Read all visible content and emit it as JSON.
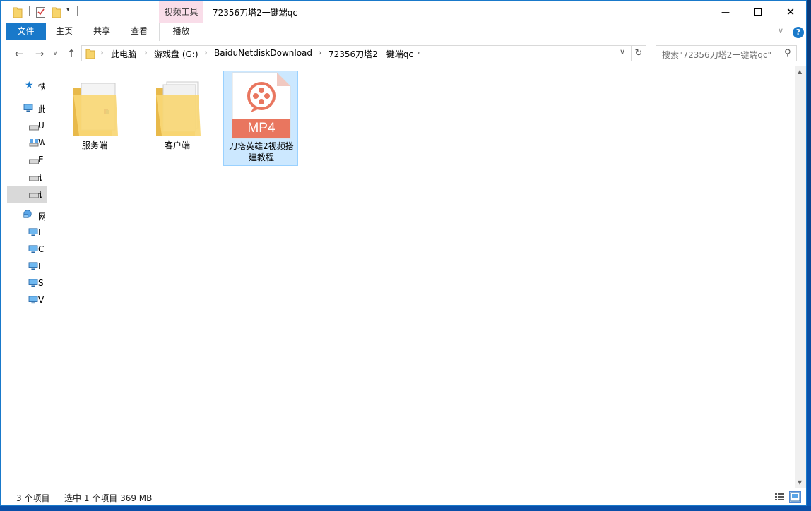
{
  "window": {
    "title": "72356刀塔2一键端qc",
    "context_tab": "视频工具",
    "controls": {
      "minimize": "—",
      "maximize": "☐",
      "close": "✕"
    }
  },
  "ribbon": {
    "tabs": [
      "文件",
      "主页",
      "共享",
      "查看",
      "播放"
    ],
    "help": "?"
  },
  "address": {
    "crumbs": [
      "此电脑",
      "游戏盘 (G:)",
      "BaiduNetdiskDownload",
      "72356刀塔2一键端qc"
    ],
    "search_placeholder": "搜索\"72356刀塔2一键端qc\""
  },
  "nav": {
    "items": [
      {
        "icon": "star-icon",
        "label": "快"
      },
      {
        "icon": "computer-icon",
        "label": "此"
      },
      {
        "icon": "drive-icon",
        "label": "U"
      },
      {
        "icon": "network-drive-icon",
        "label": "W"
      },
      {
        "icon": "drive-icon",
        "label": "E"
      },
      {
        "icon": "drive-icon",
        "label": "讠"
      },
      {
        "icon": "drive-icon",
        "label": "讠"
      },
      {
        "icon": "network-icon",
        "label": "网"
      },
      {
        "icon": "computer-icon",
        "label": "I"
      },
      {
        "icon": "computer-icon",
        "label": "C"
      },
      {
        "icon": "computer-icon",
        "label": "I"
      },
      {
        "icon": "computer-icon",
        "label": "S"
      },
      {
        "icon": "computer-icon",
        "label": "V"
      }
    ]
  },
  "files": [
    {
      "name": "服务端",
      "type": "folder"
    },
    {
      "name": "客户端",
      "type": "folder"
    },
    {
      "name": "刀塔英雄2视频搭建教程",
      "type": "mp4",
      "badge": "MP4",
      "badge_color": "#e9765f"
    }
  ],
  "status": {
    "count": "3 个项目",
    "selection": "选中 1 个项目  369 MB"
  },
  "colors": {
    "accent": "#1979ca",
    "context_tab": "#f9dde9",
    "selection": "#cce8ff"
  }
}
